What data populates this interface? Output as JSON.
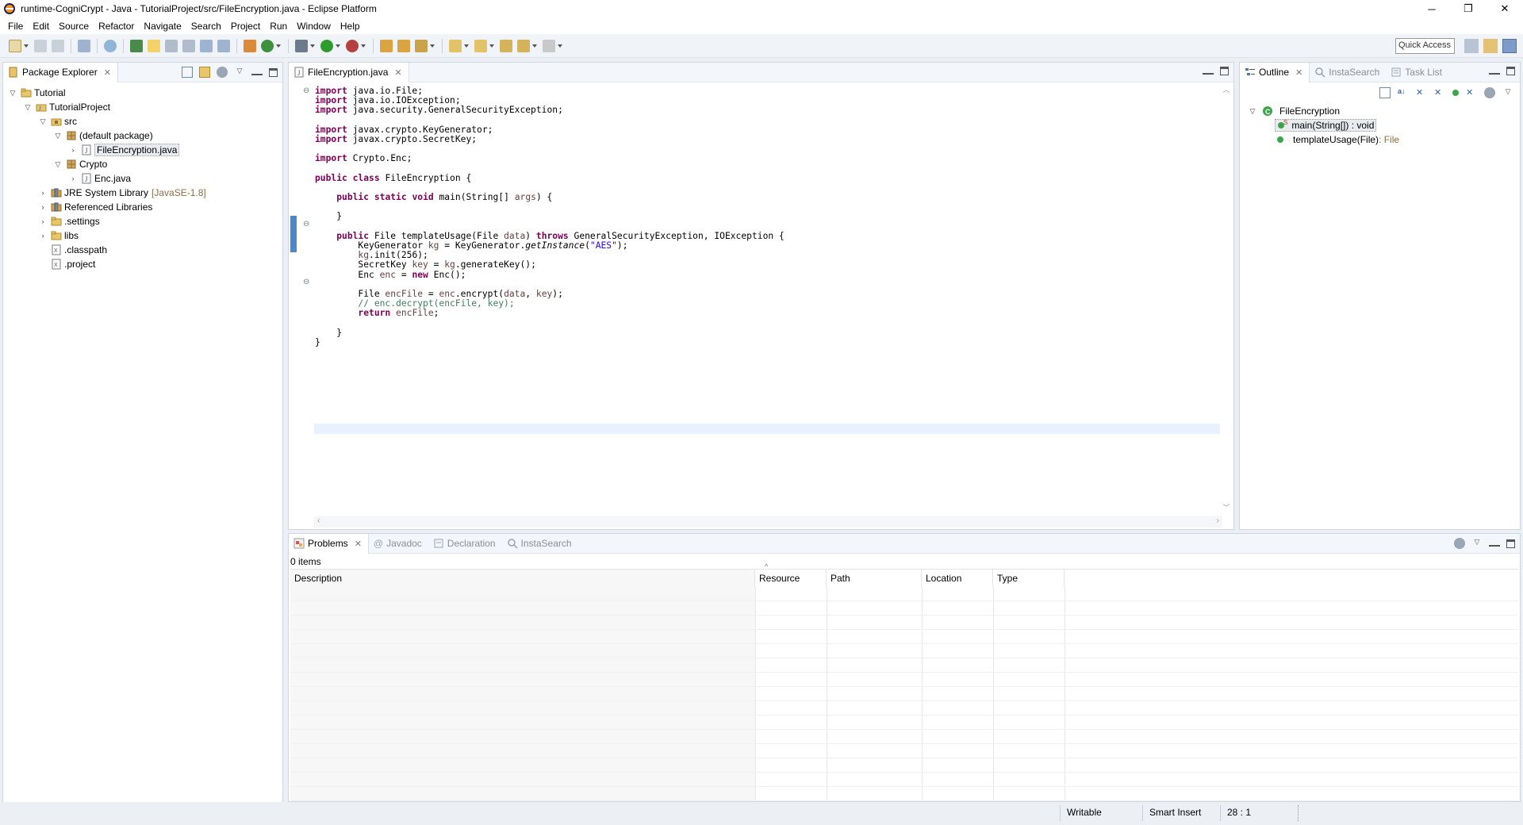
{
  "window": {
    "title": "runtime-CogniCrypt - Java - TutorialProject/src/FileEncryption.java - Eclipse Platform",
    "minimize": "─",
    "restore": "❐",
    "close": "✕"
  },
  "menu": [
    "File",
    "Edit",
    "Source",
    "Refactor",
    "Navigate",
    "Search",
    "Project",
    "Run",
    "Window",
    "Help"
  ],
  "toolbar": {
    "quick_access": "Quick Access"
  },
  "package_explorer": {
    "tab_label": "Package Explorer",
    "tree": [
      {
        "label": "Tutorial",
        "arrow": "▽",
        "icon": "folder-icon",
        "depth": 0
      },
      {
        "label": "TutorialProject",
        "arrow": "▽",
        "icon": "java-project-icon",
        "depth": 1
      },
      {
        "label": "src",
        "arrow": "▽",
        "icon": "source-folder-icon",
        "depth": 2
      },
      {
        "label": "(default package)",
        "arrow": "▽",
        "icon": "package-icon",
        "depth": 3
      },
      {
        "label": "FileEncryption.java",
        "arrow": "›",
        "icon": "java-file-icon",
        "depth": 4,
        "selected": true
      },
      {
        "label": "Crypto",
        "arrow": "▽",
        "icon": "package-icon",
        "depth": 3
      },
      {
        "label": "Enc.java",
        "arrow": "›",
        "icon": "java-file-icon",
        "depth": 4
      },
      {
        "label": "JRE System Library",
        "deco": "[JavaSE-1.8]",
        "arrow": "›",
        "icon": "library-icon",
        "depth": 2
      },
      {
        "label": "Referenced Libraries",
        "arrow": "›",
        "icon": "library-icon",
        "depth": 2
      },
      {
        "label": ".settings",
        "arrow": "›",
        "icon": "folder-icon",
        "depth": 2
      },
      {
        "label": "libs",
        "arrow": "›",
        "icon": "folder-icon",
        "depth": 2
      },
      {
        "label": ".classpath",
        "arrow": "",
        "icon": "xml-file-icon",
        "depth": 2
      },
      {
        "label": ".project",
        "arrow": "",
        "icon": "xml-file-icon",
        "depth": 2
      }
    ]
  },
  "editor": {
    "tab_label": "FileEncryption.java",
    "lines": [
      [
        [
          "kw",
          "import"
        ],
        [
          "t",
          " java.io.File;"
        ]
      ],
      [
        [
          "kw",
          "import"
        ],
        [
          "t",
          " java.io.IOException;"
        ]
      ],
      [
        [
          "kw",
          "import"
        ],
        [
          "t",
          " java.security.GeneralSecurityException;"
        ]
      ],
      [],
      [
        [
          "kw",
          "import"
        ],
        [
          "t",
          " javax.crypto.KeyGenerator;"
        ]
      ],
      [
        [
          "kw",
          "import"
        ],
        [
          "t",
          " javax.crypto.SecretKey;"
        ]
      ],
      [],
      [
        [
          "kw",
          "import"
        ],
        [
          "t",
          " Crypto.Enc;"
        ]
      ],
      [],
      [
        [
          "kw",
          "public"
        ],
        [
          "t",
          " "
        ],
        [
          "kw",
          "class"
        ],
        [
          "t",
          " FileEncryption {"
        ]
      ],
      [],
      [
        [
          "t",
          "    "
        ],
        [
          "kw",
          "public"
        ],
        [
          "t",
          " "
        ],
        [
          "kw",
          "static"
        ],
        [
          "t",
          " "
        ],
        [
          "kw",
          "void"
        ],
        [
          "t",
          " main(String[] "
        ],
        [
          "var",
          "args"
        ],
        [
          "t",
          ") {"
        ]
      ],
      [],
      [
        [
          "t",
          "    }"
        ]
      ],
      [],
      [
        [
          "t",
          "    "
        ],
        [
          "kw",
          "public"
        ],
        [
          "t",
          " File templateUsage(File "
        ],
        [
          "var",
          "data"
        ],
        [
          "t",
          ") "
        ],
        [
          "kw",
          "throws"
        ],
        [
          "t",
          " GeneralSecurityException, IOException {"
        ]
      ],
      [
        [
          "t",
          "        KeyGenerator "
        ],
        [
          "var",
          "kg"
        ],
        [
          "t",
          " = KeyGenerator."
        ],
        [
          "it",
          "getInstance"
        ],
        [
          "t",
          "("
        ],
        [
          "str",
          "\"AES\""
        ],
        [
          "t",
          ");"
        ]
      ],
      [
        [
          "t",
          "        "
        ],
        [
          "var",
          "kg"
        ],
        [
          "t",
          ".init(256);"
        ]
      ],
      [
        [
          "t",
          "        SecretKey "
        ],
        [
          "var",
          "key"
        ],
        [
          "t",
          " = "
        ],
        [
          "var",
          "kg"
        ],
        [
          "t",
          ".generateKey();"
        ]
      ],
      [
        [
          "t",
          "        Enc "
        ],
        [
          "var",
          "enc"
        ],
        [
          "t",
          " = "
        ],
        [
          "kw",
          "new"
        ],
        [
          "t",
          " Enc();"
        ]
      ],
      [],
      [
        [
          "t",
          "        File "
        ],
        [
          "var",
          "encFile"
        ],
        [
          "t",
          " = "
        ],
        [
          "var",
          "enc"
        ],
        [
          "t",
          ".encrypt("
        ],
        [
          "var",
          "data"
        ],
        [
          "t",
          ", "
        ],
        [
          "var",
          "key"
        ],
        [
          "t",
          ");"
        ]
      ],
      [
        [
          "cm",
          "        // enc.decrypt(encFile, key);"
        ]
      ],
      [
        [
          "t",
          "        "
        ],
        [
          "kw",
          "return"
        ],
        [
          "t",
          " "
        ],
        [
          "var",
          "encFile"
        ],
        [
          "t",
          ";"
        ]
      ],
      [],
      [
        [
          "t",
          "    }"
        ]
      ],
      [
        [
          "t",
          "}"
        ]
      ],
      []
    ]
  },
  "outline": {
    "tabs": [
      "Outline",
      "InstaSearch",
      "Task List"
    ],
    "class_name": "FileEncryption",
    "members": [
      {
        "label": "main(String[]) : void",
        "type": "",
        "static": true,
        "selected": true
      },
      {
        "label": "templateUsage(File)",
        "type": " : File",
        "static": false
      }
    ],
    "static_marker": "S"
  },
  "problems": {
    "tabs": [
      "Problems",
      "Javadoc",
      "Declaration",
      "InstaSearch"
    ],
    "count": "0 items",
    "columns": [
      "Description",
      "Resource",
      "Path",
      "Location",
      "Type"
    ],
    "sort_indicator": "^"
  },
  "status": {
    "writable": "Writable",
    "insert_mode": "Smart Insert",
    "position": "28 : 1"
  },
  "colors": {
    "keyword": "#7f0055",
    "string": "#2a00ff",
    "comment": "#3f7f5f",
    "variable": "#6a3e3e"
  }
}
